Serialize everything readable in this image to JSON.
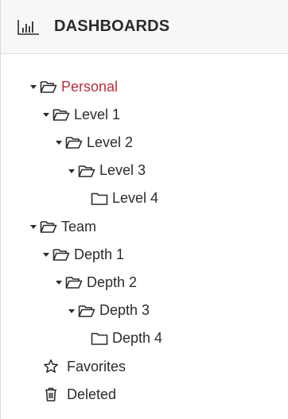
{
  "header": {
    "title": "DASHBOARDS",
    "icon": "bar-chart-icon"
  },
  "tree": [
    {
      "label": "Personal",
      "active": true,
      "expanded": true,
      "depth": 0,
      "name": "tree-node-personal"
    },
    {
      "label": "Level 1",
      "expanded": true,
      "depth": 1,
      "name": "tree-node-level-1"
    },
    {
      "label": "Level 2",
      "expanded": true,
      "depth": 2,
      "name": "tree-node-level-2"
    },
    {
      "label": "Level 3",
      "expanded": true,
      "depth": 3,
      "name": "tree-node-level-3"
    },
    {
      "label": "Level 4",
      "expanded": false,
      "leaf": true,
      "depth": 4,
      "name": "tree-node-level-4"
    },
    {
      "label": "Team",
      "expanded": true,
      "depth": 0,
      "name": "tree-node-team"
    },
    {
      "label": "Depth 1",
      "expanded": true,
      "depth": 1,
      "name": "tree-node-depth-1"
    },
    {
      "label": "Depth 2",
      "expanded": true,
      "depth": 2,
      "name": "tree-node-depth-2"
    },
    {
      "label": "Depth 3",
      "expanded": true,
      "depth": 3,
      "name": "tree-node-depth-3"
    },
    {
      "label": "Depth 4",
      "expanded": false,
      "leaf": true,
      "depth": 4,
      "name": "tree-node-depth-4"
    }
  ],
  "special": [
    {
      "label": "Favorites",
      "icon": "star-icon",
      "name": "favorites-item"
    },
    {
      "label": "Deleted",
      "icon": "trash-icon",
      "name": "deleted-item"
    }
  ],
  "colors": {
    "active": "#c0283c",
    "text": "#2b2b2b",
    "header_bg": "#f7f7f7"
  }
}
